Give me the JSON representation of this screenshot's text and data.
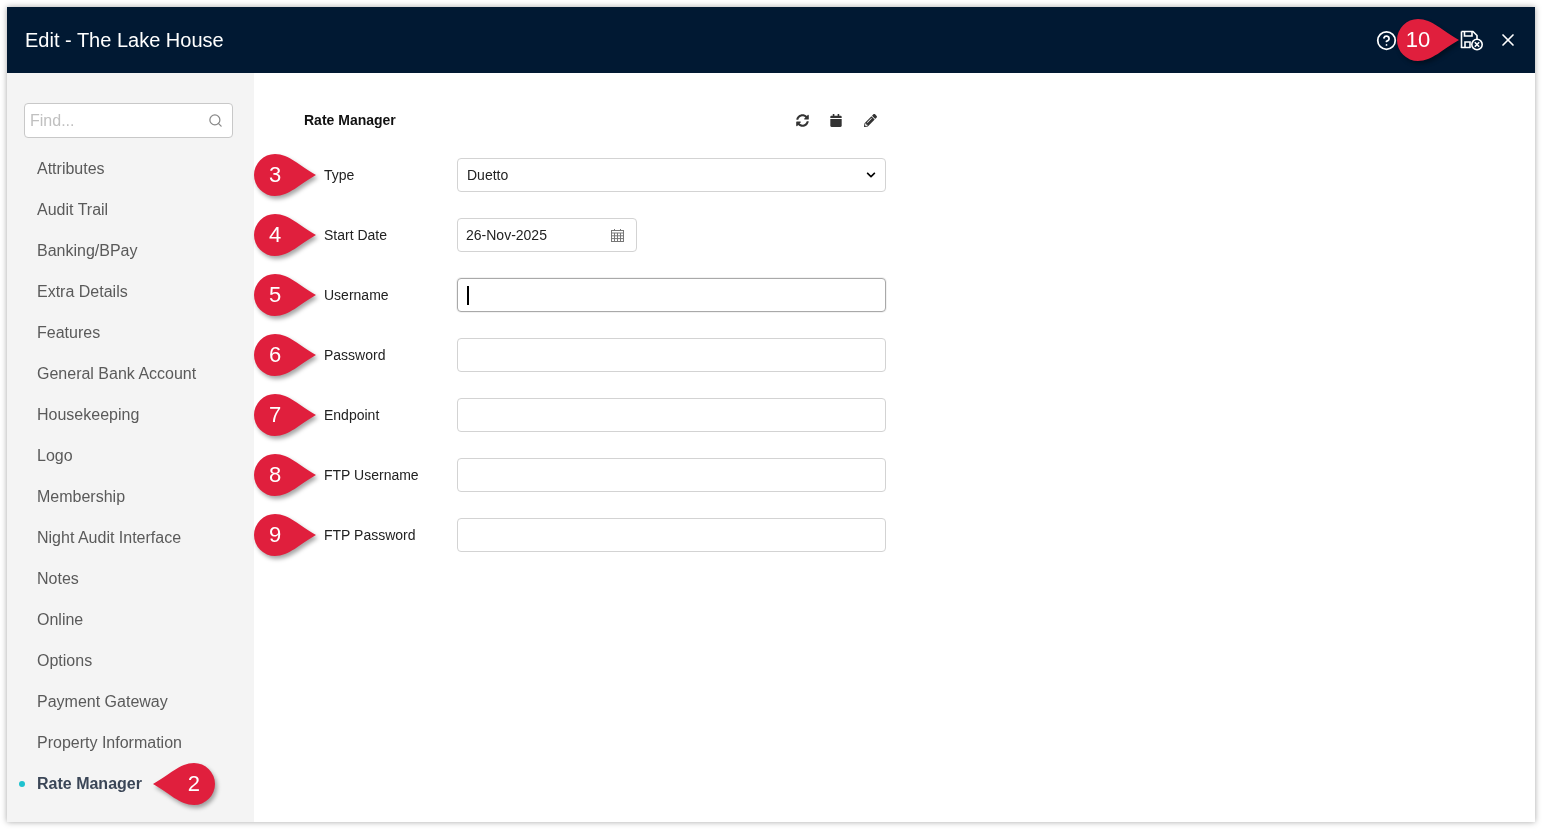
{
  "window": {
    "title": "Edit - The Lake House",
    "callout": "10"
  },
  "sidebar": {
    "search": {
      "placeholder": "Find..."
    },
    "items": [
      {
        "label": "Attributes",
        "selected": false
      },
      {
        "label": "Audit Trail",
        "selected": false
      },
      {
        "label": "Banking/BPay",
        "selected": false
      },
      {
        "label": "Extra Details",
        "selected": false
      },
      {
        "label": "Features",
        "selected": false
      },
      {
        "label": "General Bank Account",
        "selected": false
      },
      {
        "label": "Housekeeping",
        "selected": false
      },
      {
        "label": "Logo",
        "selected": false
      },
      {
        "label": "Membership",
        "selected": false
      },
      {
        "label": "Night Audit Interface",
        "selected": false
      },
      {
        "label": "Notes",
        "selected": false
      },
      {
        "label": "Online",
        "selected": false
      },
      {
        "label": "Options",
        "selected": false
      },
      {
        "label": "Payment Gateway",
        "selected": false
      },
      {
        "label": "Property Information",
        "selected": false
      },
      {
        "label": "Rate Manager",
        "selected": true,
        "callout": "2"
      }
    ]
  },
  "panel": {
    "title": "Rate Manager",
    "fields": [
      {
        "kind": "select",
        "label": "Type",
        "value": "Duetto",
        "callout": "3"
      },
      {
        "kind": "date",
        "label": "Start Date",
        "value": "26-Nov-2025",
        "callout": "4"
      },
      {
        "kind": "text",
        "label": "Username",
        "focused": true,
        "callout": "5"
      },
      {
        "kind": "text",
        "label": "Password",
        "focused": false,
        "callout": "6"
      },
      {
        "kind": "text",
        "label": "Endpoint",
        "focused": false,
        "callout": "7"
      },
      {
        "kind": "text",
        "label": "FTP Username",
        "focused": false,
        "callout": "8"
      },
      {
        "kind": "text",
        "label": "FTP Password",
        "focused": false,
        "callout": "9"
      }
    ]
  }
}
